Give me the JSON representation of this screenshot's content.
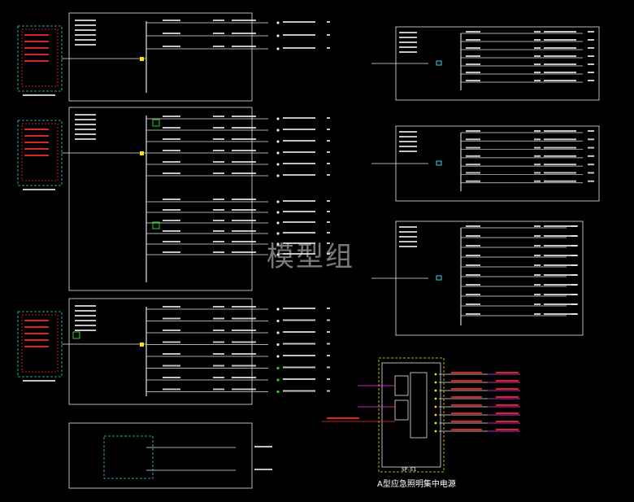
{
  "watermark": "模型组",
  "bottom_caption": "A型应急照明集中电源",
  "device_label": "SP-E1",
  "colors": {
    "background": "#000000",
    "frame": "#e6e6e6",
    "red": "#ff2a2a",
    "green": "#22dd22",
    "yellow": "#ffe000",
    "cyan": "#33d6e6",
    "magenta": "#ff33ff"
  }
}
